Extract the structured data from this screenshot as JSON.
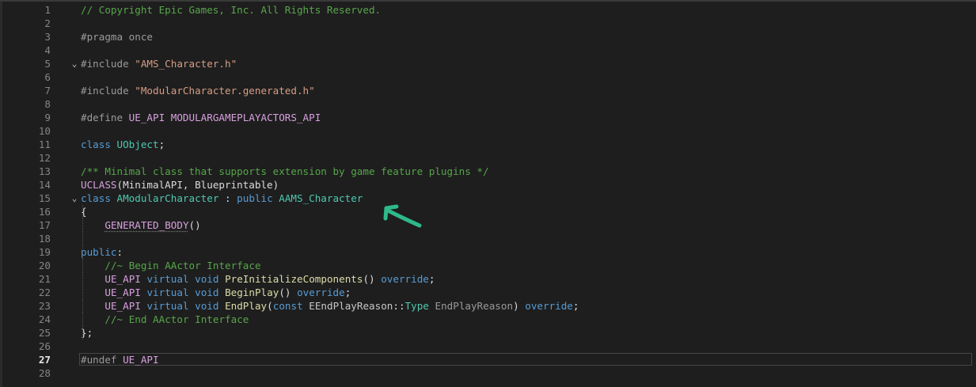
{
  "editor": {
    "active_line": "27",
    "annotation_color": "#2fb98a",
    "lines": [
      {
        "num": "1",
        "tokens": [
          {
            "t": "// Copyright Epic Games, Inc. All Rights Reserved.",
            "c": "comment"
          }
        ]
      },
      {
        "num": "2",
        "tokens": []
      },
      {
        "num": "3",
        "tokens": [
          {
            "t": "#pragma once",
            "c": "pre"
          }
        ]
      },
      {
        "num": "4",
        "tokens": []
      },
      {
        "num": "5",
        "fold": "⌄",
        "tokens": [
          {
            "t": "#include ",
            "c": "pre"
          },
          {
            "t": "\"AMS_Character.h\"",
            "c": "string"
          }
        ]
      },
      {
        "num": "6",
        "tokens": []
      },
      {
        "num": "7",
        "tokens": [
          {
            "t": "#include ",
            "c": "pre"
          },
          {
            "t": "\"ModularCharacter.generated.h\"",
            "c": "string"
          }
        ]
      },
      {
        "num": "8",
        "tokens": []
      },
      {
        "num": "9",
        "tokens": [
          {
            "t": "#define ",
            "c": "pre"
          },
          {
            "t": "UE_API ",
            "c": "macro-bold"
          },
          {
            "t": "MODULARGAMEPLAYACTORS_API",
            "c": "macro-bold"
          }
        ]
      },
      {
        "num": "10",
        "tokens": []
      },
      {
        "num": "11",
        "tokens": [
          {
            "t": "class ",
            "c": "keyword"
          },
          {
            "t": "UObject",
            "c": "class"
          },
          {
            "t": ";",
            "c": "plain"
          }
        ]
      },
      {
        "num": "12",
        "tokens": []
      },
      {
        "num": "13",
        "tokens": [
          {
            "t": "/** Minimal class that supports extension by game feature plugins */",
            "c": "comment"
          }
        ]
      },
      {
        "num": "14",
        "tokens": [
          {
            "t": "UCLASS",
            "c": "macro-bold"
          },
          {
            "t": "(MinimalAPI, Blueprintable)",
            "c": "plain"
          }
        ]
      },
      {
        "num": "15",
        "fold": "⌄",
        "tokens": [
          {
            "t": "class ",
            "c": "keyword"
          },
          {
            "t": "AModularCharacter",
            "c": "class"
          },
          {
            "t": " : ",
            "c": "plain"
          },
          {
            "t": "public ",
            "c": "keyword"
          },
          {
            "t": "AAMS_Character",
            "c": "class"
          }
        ]
      },
      {
        "num": "16",
        "tokens": [
          {
            "t": "{",
            "c": "plain"
          }
        ]
      },
      {
        "num": "17",
        "indent": 1,
        "tokens": [
          {
            "t": "GENERATED_BODY",
            "c": "macro-bold",
            "squig": true
          },
          {
            "t": "()",
            "c": "plain"
          }
        ]
      },
      {
        "num": "18",
        "indent": 1,
        "tokens": []
      },
      {
        "num": "19",
        "tokens": [
          {
            "t": "public",
            "c": "keyword"
          },
          {
            "t": ":",
            "c": "plain"
          }
        ]
      },
      {
        "num": "20",
        "indent": 1,
        "tokens": [
          {
            "t": "//~ Begin AActor Interface",
            "c": "comment"
          }
        ]
      },
      {
        "num": "21",
        "indent": 1,
        "tokens": [
          {
            "t": "UE_API ",
            "c": "macro-bold"
          },
          {
            "t": "virtual ",
            "c": "keyword"
          },
          {
            "t": "void ",
            "c": "keyword"
          },
          {
            "t": "PreInitializeComponents",
            "c": "func"
          },
          {
            "t": "() ",
            "c": "plain"
          },
          {
            "t": "override",
            "c": "keyword"
          },
          {
            "t": ";",
            "c": "plain"
          }
        ]
      },
      {
        "num": "22",
        "indent": 1,
        "tokens": [
          {
            "t": "UE_API ",
            "c": "macro-bold"
          },
          {
            "t": "virtual ",
            "c": "keyword"
          },
          {
            "t": "void ",
            "c": "keyword"
          },
          {
            "t": "BeginPlay",
            "c": "func"
          },
          {
            "t": "() ",
            "c": "plain"
          },
          {
            "t": "override",
            "c": "keyword"
          },
          {
            "t": ";",
            "c": "plain"
          }
        ]
      },
      {
        "num": "23",
        "indent": 1,
        "tokens": [
          {
            "t": "UE_API ",
            "c": "macro-bold"
          },
          {
            "t": "virtual ",
            "c": "keyword"
          },
          {
            "t": "void ",
            "c": "keyword"
          },
          {
            "t": "EndPlay",
            "c": "func"
          },
          {
            "t": "(",
            "c": "plain"
          },
          {
            "t": "const ",
            "c": "keyword"
          },
          {
            "t": "EEndPlayReason",
            "c": "ident"
          },
          {
            "t": "::",
            "c": "plain"
          },
          {
            "t": "Type ",
            "c": "type"
          },
          {
            "t": "EndPlayReason",
            "c": "param"
          },
          {
            "t": ") ",
            "c": "plain"
          },
          {
            "t": "override",
            "c": "keyword"
          },
          {
            "t": ";",
            "c": "plain"
          }
        ]
      },
      {
        "num": "24",
        "indent": 1,
        "tokens": [
          {
            "t": "//~ End AActor Interface",
            "c": "comment"
          }
        ]
      },
      {
        "num": "25",
        "tokens": [
          {
            "t": "};",
            "c": "plain"
          }
        ]
      },
      {
        "num": "26",
        "tokens": []
      },
      {
        "num": "27",
        "current": true,
        "tokens": [
          {
            "t": "#undef ",
            "c": "pre"
          },
          {
            "t": "UE_API",
            "c": "macro-bold"
          }
        ]
      },
      {
        "num": "28",
        "tokens": []
      }
    ]
  }
}
